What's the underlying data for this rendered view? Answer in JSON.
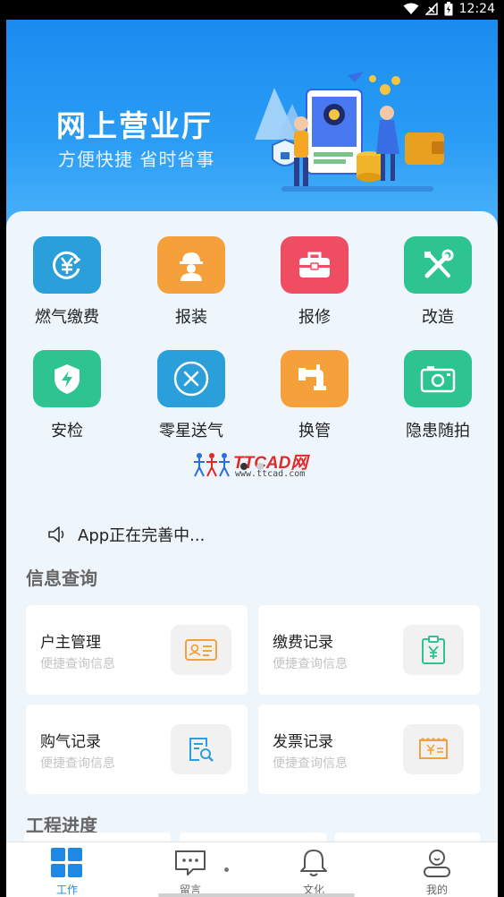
{
  "status_bar": {
    "time": "12:24"
  },
  "banner": {
    "title": "网上营业厅",
    "subtitle": "方便快捷  省时省事"
  },
  "functions": [
    {
      "label": "燃气缴费",
      "icon": "yen-refresh-icon",
      "color": "#2aa3f0"
    },
    {
      "label": "报装",
      "icon": "worker-icon",
      "color": "#f59a2b"
    },
    {
      "label": "报修",
      "icon": "toolbox-icon",
      "color": "#f0475e"
    },
    {
      "label": "改造",
      "icon": "tools-icon",
      "color": "#22cc8c"
    },
    {
      "label": "安检",
      "icon": "shield-bolt-icon",
      "color": "#22cc8c"
    },
    {
      "label": "零星送气",
      "icon": "close-circle-icon",
      "color": "#2aa3f0"
    },
    {
      "label": "换管",
      "icon": "pipe-icon",
      "color": "#f59a2b"
    },
    {
      "label": "隐患随拍",
      "icon": "camera-icon",
      "color": "#22cc8c"
    }
  ],
  "watermark": {
    "brand": "TTCAD网",
    "url": "www.ttcad.com"
  },
  "notice": {
    "text": "App正在完善中..."
  },
  "info_section": {
    "title": "信息查询",
    "cards": [
      {
        "title": "户主管理",
        "subtitle": "便捷查询信息",
        "icon": "id-card-icon"
      },
      {
        "title": "缴费记录",
        "subtitle": "便捷查询信息",
        "icon": "payment-clipboard-icon"
      },
      {
        "title": "购气记录",
        "subtitle": "便捷查询信息",
        "icon": "document-search-icon"
      },
      {
        "title": "发票记录",
        "subtitle": "便捷查询信息",
        "icon": "invoice-icon"
      }
    ]
  },
  "project_section": {
    "title": "工程进度"
  },
  "bottom_nav": [
    {
      "label": "工作",
      "icon": "grid-icon",
      "active": true
    },
    {
      "label": "留言",
      "icon": "message-icon",
      "active": false
    },
    {
      "label": "文化",
      "icon": "bell-icon",
      "active": false
    },
    {
      "label": "我的",
      "icon": "user-icon",
      "active": false
    }
  ],
  "colors": {
    "primary": "#1e88e5",
    "banner": "#1a8cf0",
    "orange_icon": "#f5a03a",
    "green_icon": "#2dc491",
    "blue_icon": "#2a9fd9"
  }
}
